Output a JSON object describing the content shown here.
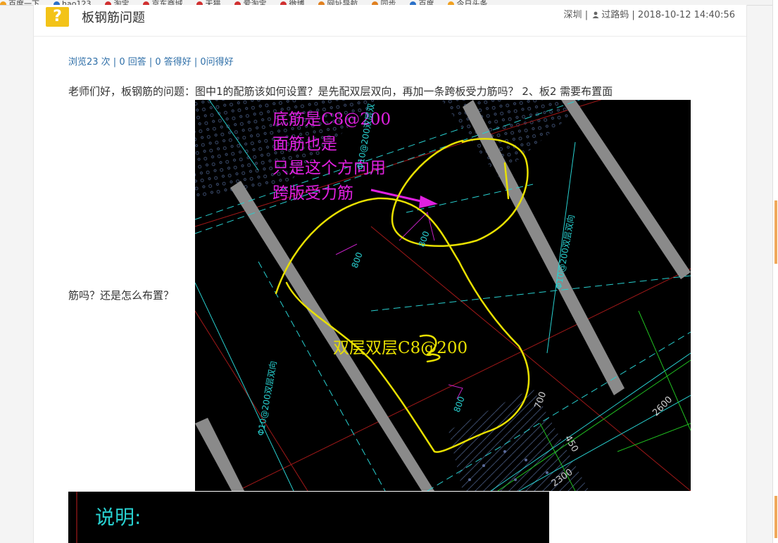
{
  "browser": {
    "bookmarks": [
      "百度一下",
      "hao123",
      "淘宝",
      "京东商城",
      "天猫",
      "爱淘宝",
      "微博",
      "网址导航",
      "同步",
      "百度",
      "今日头条"
    ]
  },
  "question": {
    "title": "板钢筋问题",
    "location": "深圳",
    "separator": "|",
    "username": "过路蚂",
    "datetime": "2018-10-12 14:40:56",
    "stats": "浏览23 次 | 0 回答 | 0 答得好 | 0问得好",
    "body_line1": "老师们好，板钢筋的问题：图中1的配筋该如何设置？是先配双层双向，再加一条跨板受力筋吗？ 2、板2 需要布置面",
    "body_line2": "筋吗？还是怎么布置？"
  },
  "drawing": {
    "annotation_lines": [
      "底筋是C8@200",
      "面筋也是",
      "只是这个方向用",
      "跨版受力筋"
    ],
    "annotation_2": "双层双层C8@200",
    "dim_800_a": "800",
    "dim_800_b": "800",
    "dim_800_c": "800",
    "rebar_label_1": "Φ10@200双层双向",
    "rebar_label_2": "Φ10@200双层双向",
    "rebar_label_3": "Φ10@200双层双",
    "dim_700": "700",
    "dim_450": "450",
    "dim_2300": "2300",
    "dim_2600": "2600",
    "note_title": "说明:"
  },
  "colors": {
    "accent": "#f3c318",
    "link": "#2f6fa8",
    "cad_magenta": "#e020e0",
    "cad_yellow": "#e8e000",
    "cad_cyan": "#28d0d0",
    "cad_green": "#20c020",
    "cad_red": "#c02020"
  }
}
